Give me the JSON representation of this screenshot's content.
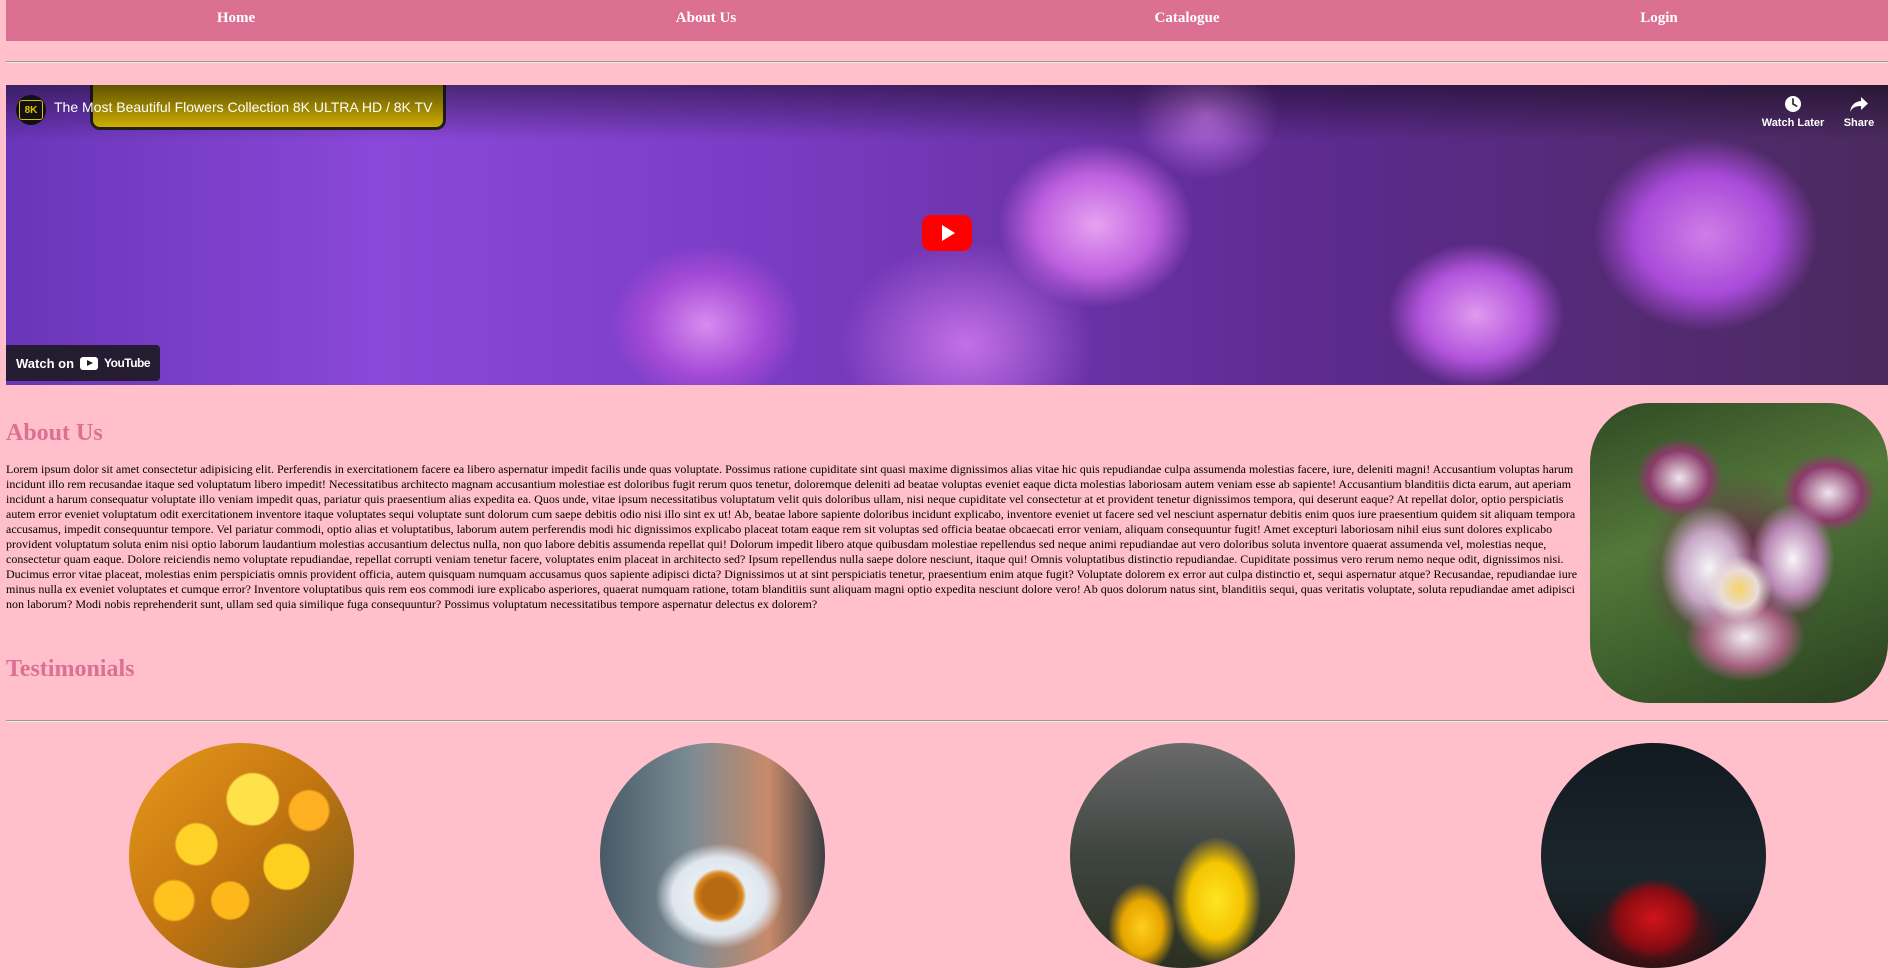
{
  "nav": {
    "items": [
      {
        "label": "Home"
      },
      {
        "label": "About Us"
      },
      {
        "label": "Catalogue"
      },
      {
        "label": "Login"
      }
    ]
  },
  "video": {
    "channel_logo_text": "8K",
    "title": "The Most Beautiful Flowers Collection 8K ULTRA HD / 8K TV",
    "watch_later_label": "Watch Later",
    "share_label": "Share",
    "watch_on_label": "Watch on",
    "youtube_label": "YouTube"
  },
  "about": {
    "heading": "About Us",
    "text": "Lorem ipsum dolor sit amet consectetur adipisicing elit. Perferendis in exercitationem facere ea libero aspernatur impedit facilis unde quas voluptate. Possimus ratione cupiditate sint quasi maxime dignissimos alias vitae hic quis repudiandae culpa assumenda molestias facere, iure, deleniti magni! Accusantium voluptas harum incidunt illo rem recusandae itaque sed voluptatum libero impedit! Necessitatibus architecto magnam accusantium molestiae est doloribus fugit rerum quos tenetur, doloremque deleniti ad beatae voluptas eveniet eaque dicta molestias laboriosam autem veniam esse ab sapiente! Accusantium blanditiis dicta earum, aut aperiam incidunt a harum consequatur voluptate illo veniam impedit quas, pariatur quis praesentium alias expedita ea. Quos unde, vitae ipsum necessitatibus voluptatum velit quis doloribus ullam, nisi neque cupiditate vel consectetur at et provident tenetur dignissimos tempora, qui deserunt eaque? At repellat dolor, optio perspiciatis autem error eveniet voluptatum odit exercitationem inventore itaque voluptates sequi voluptate sunt dolorum cum saepe debitis odio nisi illo sint ex ut! Ab, beatae labore sapiente doloribus incidunt explicabo, inventore eveniet ut facere sed vel nesciunt aspernatur debitis enim quos iure praesentium quidem sit aliquam tempora accusamus, impedit consequuntur tempore. Vel pariatur commodi, optio alias et voluptatibus, laborum autem perferendis modi hic dignissimos explicabo placeat totam eaque rem sit voluptas sed officia beatae obcaecati error veniam, aliquam consequuntur fugit! Amet excepturi laboriosam nihil eius sunt dolores explicabo provident voluptatum soluta enim nisi optio laborum laudantium molestias accusantium delectus nulla, non quo labore debitis assumenda repellat qui! Dolorum impedit libero atque quibusdam molestiae repellendus sed neque animi repudiandae aut vero doloribus soluta inventore quaerat assumenda vel, molestias neque, consectetur quam eaque. Dolore reiciendis nemo voluptate repudiandae, repellat corrupti veniam tenetur facere, voluptates enim placeat in architecto sed? Ipsum repellendus nulla saepe dolore nesciunt, itaque qui! Omnis voluptatibus distinctio repudiandae. Cupiditate possimus vero rerum nemo neque odit, dignissimos nisi. Ducimus error vitae placeat, molestias enim perspiciatis omnis provident officia, autem quisquam numquam accusamus quos sapiente adipisci dicta? Dignissimos ut at sint perspiciatis tenetur, praesentium enim atque fugit? Voluptate dolorem ex error aut culpa distinctio et, sequi aspernatur atque? Recusandae, repudiandae iure minus nulla ex eveniet voluptates et cumque error? Inventore voluptatibus quis rem eos commodi iure explicabo asperiores, quaerat numquam ratione, totam blanditiis sunt aliquam magni optio expedita nesciunt dolore vero! Ab quos dolorum natus sint, blanditiis sequi, quas veritatis voluptate, soluta repudiandae amet adipisci non laborum? Modi nobis reprehenderit sunt, ullam sed quia similique fuga consequuntur? Possimus voluptatum necessitatibus tempore aspernatur delectus ex dolorem?"
  },
  "testimonials": {
    "heading": "Testimonials"
  },
  "colors": {
    "page_background": "#ffc0cb",
    "nav_background": "#db7093",
    "heading": "#db7093",
    "play_button": "#ff0000"
  }
}
